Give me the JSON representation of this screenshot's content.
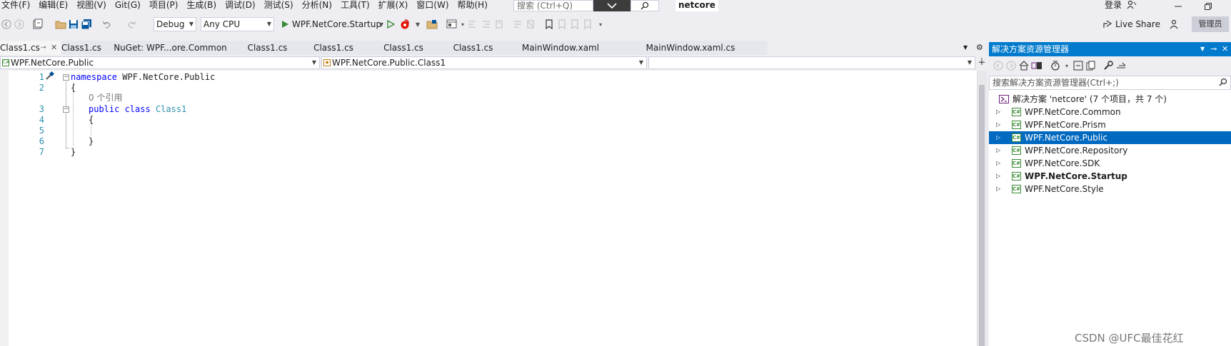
{
  "menu": [
    "文件(F)",
    "编辑(E)",
    "视图(V)",
    "Git(G)",
    "项目(P)",
    "生成(B)",
    "调试(D)",
    "测试(S)",
    "分析(N)",
    "工具(T)",
    "扩展(X)",
    "窗口(W)",
    "帮助(H)"
  ],
  "search": {
    "placeholder": "搜索 (Ctrl+Q)"
  },
  "app_title": "netcore",
  "login": "登录",
  "toolbar": {
    "config": "Debug",
    "platform": "Any CPU",
    "startup": "WPF.NetCore.Startup",
    "live_share": "Live Share",
    "admin": "管理员"
  },
  "doc_tabs": [
    "Class1.cs",
    "Class1.cs",
    "NuGet: WPF...ore.Common",
    "Class1.cs",
    "Class1.cs",
    "Class1.cs",
    "Class1.cs",
    "MainWindow.xaml",
    "MainWindow.xaml.cs"
  ],
  "navbar": {
    "project": "WPF.NetCore.Public",
    "type": "WPF.NetCore.Public.Class1",
    "member": ""
  },
  "editor": {
    "line_numbers": [
      "1",
      "2",
      "3",
      "4",
      "5",
      "6",
      "7"
    ],
    "ref_count": "0 个引用",
    "kw_namespace": "namespace",
    "ns_name": " WPF.NetCore.Public",
    "open1": "{",
    "kw_public": "public",
    "kw_class": " class ",
    "class_name": "Class1",
    "open2": "{",
    "close2": "}",
    "close1": "}"
  },
  "solution_explorer": {
    "title": "解决方案资源管理器",
    "search_placeholder": "搜索解决方案资源管理器(Ctrl+;)",
    "solution": "解决方案 'netcore' (7 个项目，共 7 个)",
    "projects": [
      {
        "name": "WPF.NetCore.Common",
        "selected": false,
        "bold": false
      },
      {
        "name": "WPF.NetCore.Prism",
        "selected": false,
        "bold": false
      },
      {
        "name": "WPF.NetCore.Public",
        "selected": true,
        "bold": false
      },
      {
        "name": "WPF.NetCore.Repository",
        "selected": false,
        "bold": false
      },
      {
        "name": "WPF.NetCore.SDK",
        "selected": false,
        "bold": false
      },
      {
        "name": "WPF.NetCore.Startup",
        "selected": false,
        "bold": true
      },
      {
        "name": "WPF.NetCore.Style",
        "selected": false,
        "bold": false
      }
    ]
  },
  "watermark": "CSDN @UFC最佳花红",
  "colors": {
    "accent": "#007acc",
    "selection": "#0069c0",
    "keyword": "#0000ff",
    "type": "#2b91af"
  }
}
